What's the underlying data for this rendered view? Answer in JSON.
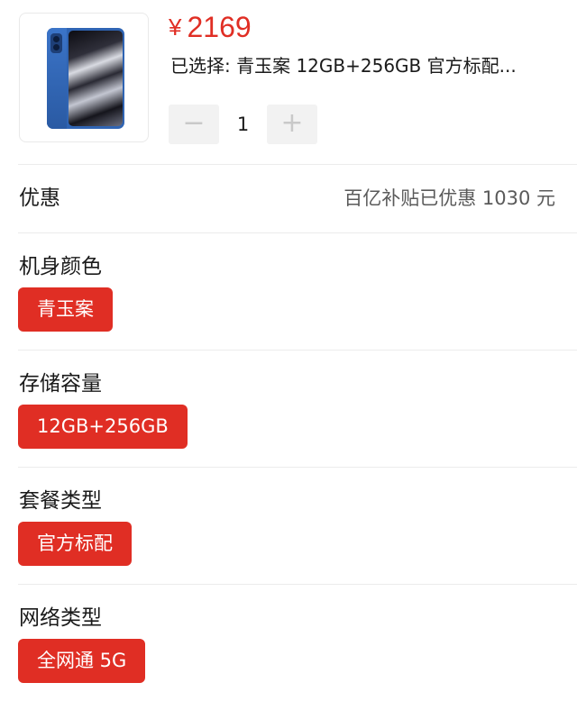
{
  "product": {
    "image_alt": "蓝色手机",
    "currency": "¥",
    "price": "2169",
    "selected_text": "已选择: 青玉案 12GB+256GB 官方标配..."
  },
  "quantity": {
    "minus_label": "−",
    "value": "1",
    "plus_label": "+"
  },
  "discount": {
    "label": "优惠",
    "value": "百亿补贴已优惠 1030 元"
  },
  "options": [
    {
      "title": "机身颜色",
      "selected": "青玉案"
    },
    {
      "title": "存储容量",
      "selected": "12GB+256GB"
    },
    {
      "title": "套餐类型",
      "selected": "官方标配"
    },
    {
      "title": "网络类型",
      "selected": "全网通 5G"
    }
  ],
  "colors": {
    "accent": "#e02e24",
    "stepper_bg": "#f2f2f2",
    "divider": "#ececec"
  }
}
